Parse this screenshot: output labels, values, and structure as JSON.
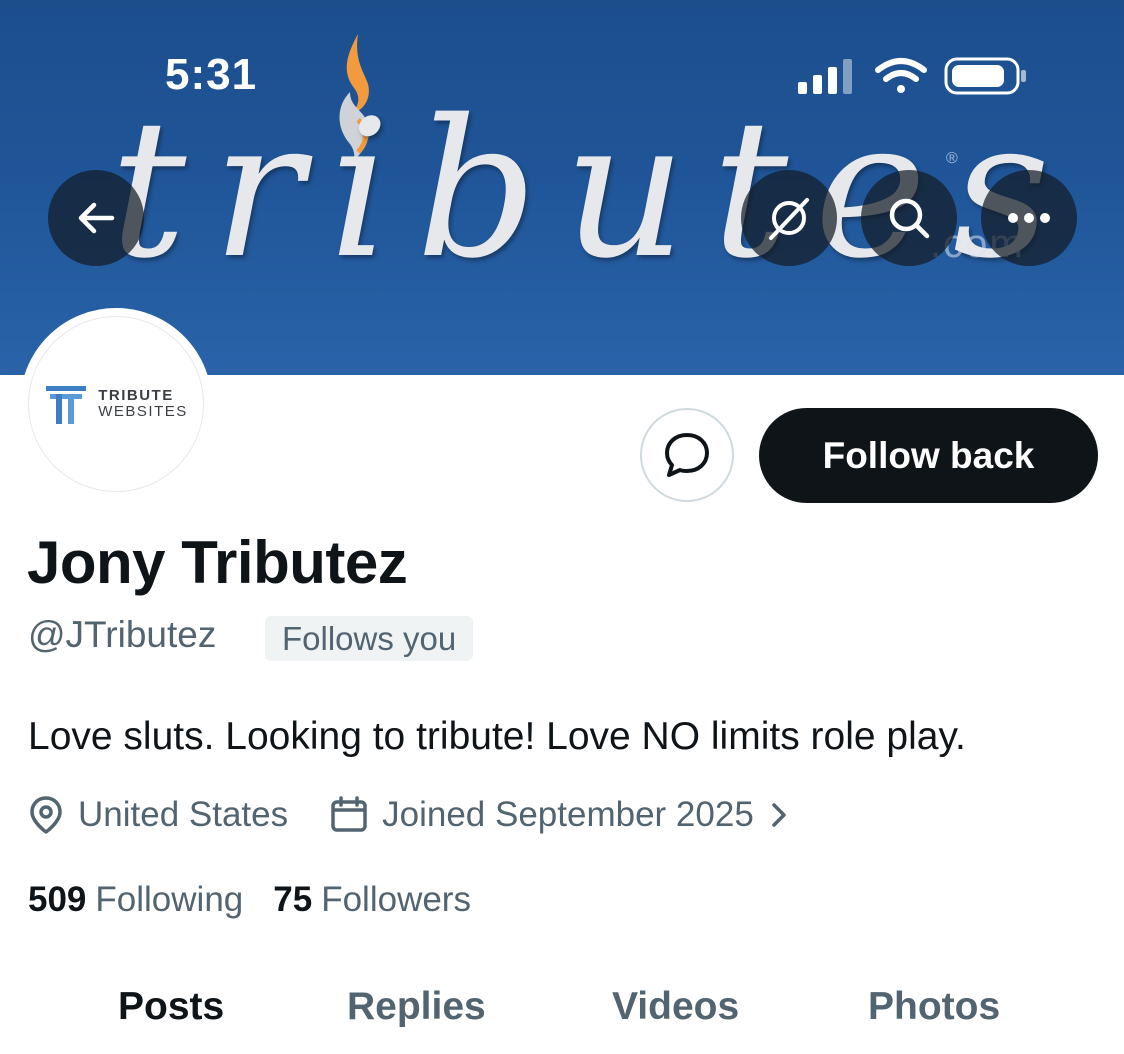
{
  "status_bar": {
    "time": "5:31"
  },
  "banner": {
    "brand_text": "tributes",
    "dotcom_text": ".com",
    "registered_mark": "®"
  },
  "header_buttons": {
    "back_icon": "arrow-left-icon",
    "grok_icon": "grok-icon",
    "search_icon": "search-icon",
    "more_icon": "more-icon"
  },
  "avatar": {
    "line1": "TRIBUTE",
    "line2": "WEBSITES"
  },
  "actions": {
    "message_icon": "message-icon",
    "follow_back_label": "Follow back"
  },
  "profile": {
    "display_name": "Jony Tributez",
    "handle": "@JTributez",
    "follows_you": "Follows you",
    "bio": "Love sluts. Looking to tribute! Love NO limits role play.",
    "location": "United States",
    "joined": "Joined September 2025"
  },
  "stats": {
    "following_count": "509",
    "following_label": "Following",
    "followers_count": "75",
    "followers_label": "Followers"
  },
  "tabs": {
    "items": [
      "Posts",
      "Replies",
      "Videos",
      "Photos"
    ],
    "active": "Posts"
  },
  "colors": {
    "banner": "#1f5598",
    "text_primary": "#0f1419",
    "text_secondary": "#536471",
    "button_dark": "#0f1419"
  }
}
